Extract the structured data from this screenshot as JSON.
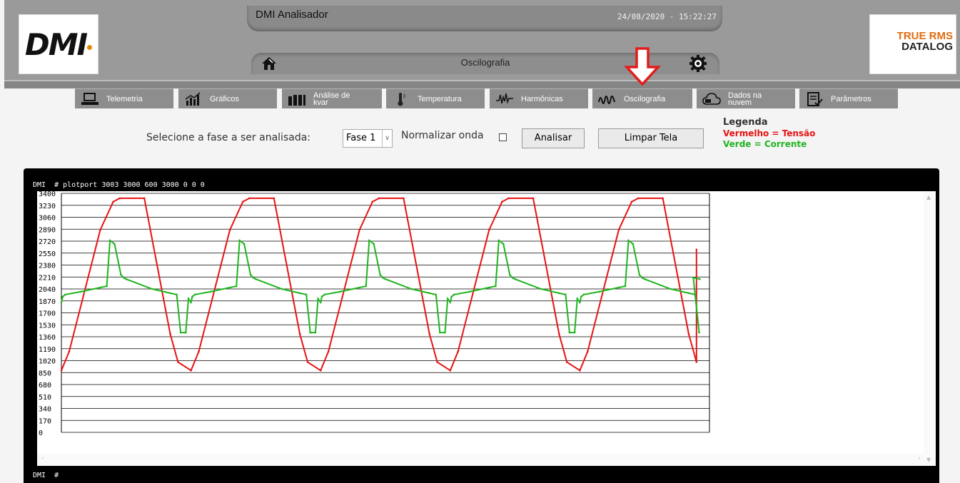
{
  "header": {
    "app_title": "DMI Analisador",
    "datetime": "24/08/2020 - 15:22:27",
    "logo_left": "DMI",
    "logo_right_line1": "TRUE RMS",
    "logo_right_line2": "DATALOG",
    "page_title": "Oscilografia",
    "home_icon": "home-icon",
    "settings_icon": "gear-icon"
  },
  "nav": [
    {
      "label": "Telemetria",
      "icon": "computer-icon"
    },
    {
      "label": "Gráficos",
      "icon": "bar-chart-icon"
    },
    {
      "label": "Análise de kvar",
      "line1": "Análise de",
      "line2": "kvar",
      "icon": "capacitor-bank-icon"
    },
    {
      "label": "Temperatura",
      "icon": "thermometer-icon"
    },
    {
      "label": "Harmônicas",
      "icon": "harmonics-wave-icon"
    },
    {
      "label": "Oscilografia",
      "icon": "oscillograph-icon"
    },
    {
      "label": "Dados na nuvem",
      "line1": "Dados na",
      "line2": "nuvem",
      "icon": "cloud-icon"
    },
    {
      "label": "Parâmetros",
      "icon": "clipboard-icon"
    }
  ],
  "controls": {
    "phase_label": "Selecione a fase a ser analisada:",
    "phase_selected": "Fase 1",
    "normalize_label": "Normalizar onda",
    "normalize_checked": false,
    "analyze_label": "Analisar",
    "clear_label": "Limpar Tela"
  },
  "legend": {
    "title": "Legenda",
    "red_text": "Vermelho = Tensão",
    "green_text": "Verde = Corrente",
    "red_color": "#e81212",
    "green_color": "#1eb51e"
  },
  "terminal": {
    "command_line": "DMI  # plotport 3003 3000 600 3000 0 0 0",
    "prompt_line": "DMI  #"
  },
  "chart_data": {
    "type": "line",
    "title": "",
    "xlabel": "",
    "ylabel": "",
    "ylim": [
      0,
      3400
    ],
    "y_ticks": [
      3400,
      3230,
      3060,
      2890,
      2720,
      2550,
      2380,
      2210,
      2040,
      1870,
      1700,
      1530,
      1360,
      1190,
      1020,
      850,
      680,
      510,
      340,
      170,
      0
    ],
    "grid": true,
    "x_range": [
      0,
      1000
    ],
    "period": 200,
    "series": [
      {
        "name": "Vermelho = Tensão",
        "color": "#e81212",
        "description": "trapezoidal voltage waveform, 4.7 cycles",
        "x": [
          0,
          12,
          60,
          80,
          90,
          128,
          168,
          180,
          200,
          212,
          260,
          280,
          290,
          328,
          368,
          380,
          400,
          412,
          460,
          480,
          490,
          528,
          568,
          580,
          600,
          612,
          660,
          680,
          690,
          728,
          768,
          780,
          800,
          812,
          860,
          880,
          890,
          928,
          968,
          980
        ],
        "values": [
          880,
          1150,
          2880,
          3280,
          3330,
          3330,
          1400,
          1000,
          880,
          1150,
          2880,
          3280,
          3330,
          3330,
          1400,
          1000,
          880,
          1150,
          2880,
          3280,
          3330,
          3330,
          1400,
          1000,
          880,
          1150,
          2880,
          3280,
          3330,
          3330,
          1400,
          1000,
          880,
          1150,
          2880,
          3280,
          3330,
          3330,
          2950,
          2600
        ]
      },
      {
        "name": "Verde = Corrente",
        "color": "#1eb51e",
        "description": "distorted current waveform with peaks near 2700 and troughs near 1420",
        "x": [
          0,
          2,
          6,
          30,
          60,
          70,
          75,
          82,
          92,
          96,
          100,
          140,
          168,
          178,
          184,
          192,
          196,
          200,
          202,
          206,
          230,
          260,
          270,
          275,
          282,
          292,
          296,
          300,
          340,
          368,
          378,
          384,
          392,
          396,
          400,
          402,
          406,
          430,
          460,
          470,
          475,
          282,
          492
        ],
        "values": [
          1850,
          1930,
          1960,
          2000,
          2060,
          2080,
          2730,
          2680,
          2240,
          2200,
          2180,
          2040,
          1980,
          1960,
          1420,
          1420,
          1900,
          1930,
          1930,
          1960,
          2000,
          2060,
          2080,
          2700,
          2650,
          2240,
          2200,
          2180,
          2040,
          1980,
          1960,
          1420,
          1420,
          1900,
          1930,
          1930,
          1960,
          2000,
          2060,
          2080,
          2700,
          2650,
          2240
        ]
      }
    ]
  }
}
